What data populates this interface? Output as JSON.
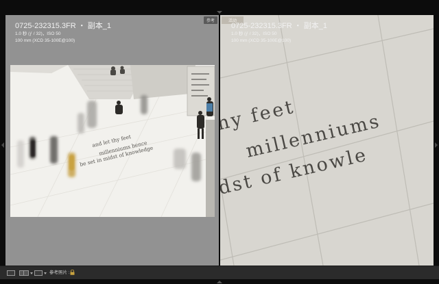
{
  "reference": {
    "tag": "参考",
    "filename": "0725-232315.3FR ・ 副本_1",
    "exposure": "1.0 秒 (ƒ / 32)，ISO 50",
    "lens": "100 mm (XCD 35-100E@100)"
  },
  "active": {
    "tag": "活动",
    "filename": "0725-232315.3FR ・ 副本_1",
    "exposure": "1.0 秒 (ƒ / 32)，ISO 50",
    "lens": "100 mm (XCD 35-100E@100)"
  },
  "photo_inscription": [
    "and let thy feet",
    "millenniums hence",
    "be set in midst of knowledge"
  ],
  "zoom_inscription": [
    "hy feet",
    "millenniums",
    "dst of knowle"
  ],
  "toolbar": {
    "reference_label": "参考照片 :",
    "icons": [
      "loupe-view-icon",
      "reference-view-icon",
      "compare-view-icon",
      "lock-icon"
    ]
  },
  "colors": {
    "panel_bg": "#929292",
    "toolbar_bg": "#2b2b2b",
    "active_tag": "#bfbab0",
    "reference_tag": "#5a5a5a"
  }
}
